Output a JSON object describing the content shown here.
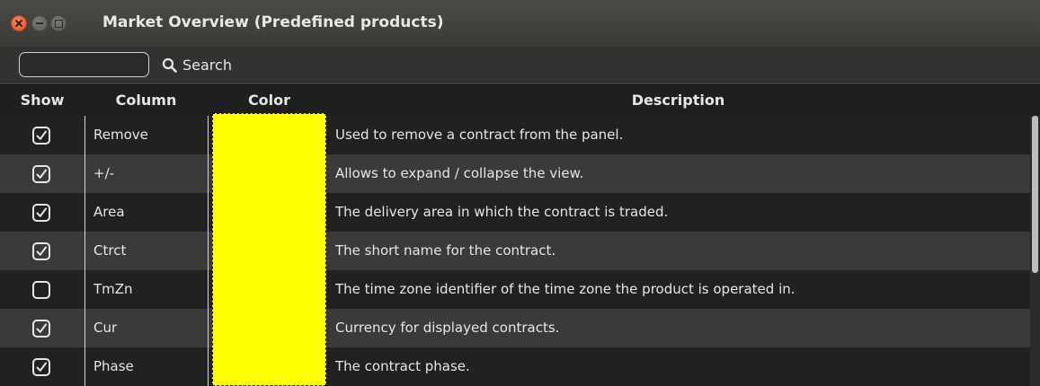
{
  "window": {
    "title": "Market Overview (Predefined products)"
  },
  "toolbar": {
    "search_value": "",
    "search_label": "Search"
  },
  "table": {
    "headers": {
      "show": "Show",
      "column": "Column",
      "color": "Color",
      "description": "Description"
    },
    "color_value": "#ffff00",
    "rows": [
      {
        "show": true,
        "column": "Remove",
        "description": "Used to remove a contract from the panel."
      },
      {
        "show": true,
        "column": "+/-",
        "description": "Allows to expand / collapse the view."
      },
      {
        "show": true,
        "column": "Area",
        "description": "The delivery area in which the contract is traded."
      },
      {
        "show": true,
        "column": "Ctrct",
        "description": "The short name for the contract."
      },
      {
        "show": false,
        "column": "TmZn",
        "description": "The time zone identifier of the time zone the product is operated in."
      },
      {
        "show": true,
        "column": "Cur",
        "description": "Currency for displayed contracts."
      },
      {
        "show": true,
        "column": "Phase",
        "description": "The contract phase."
      }
    ]
  }
}
